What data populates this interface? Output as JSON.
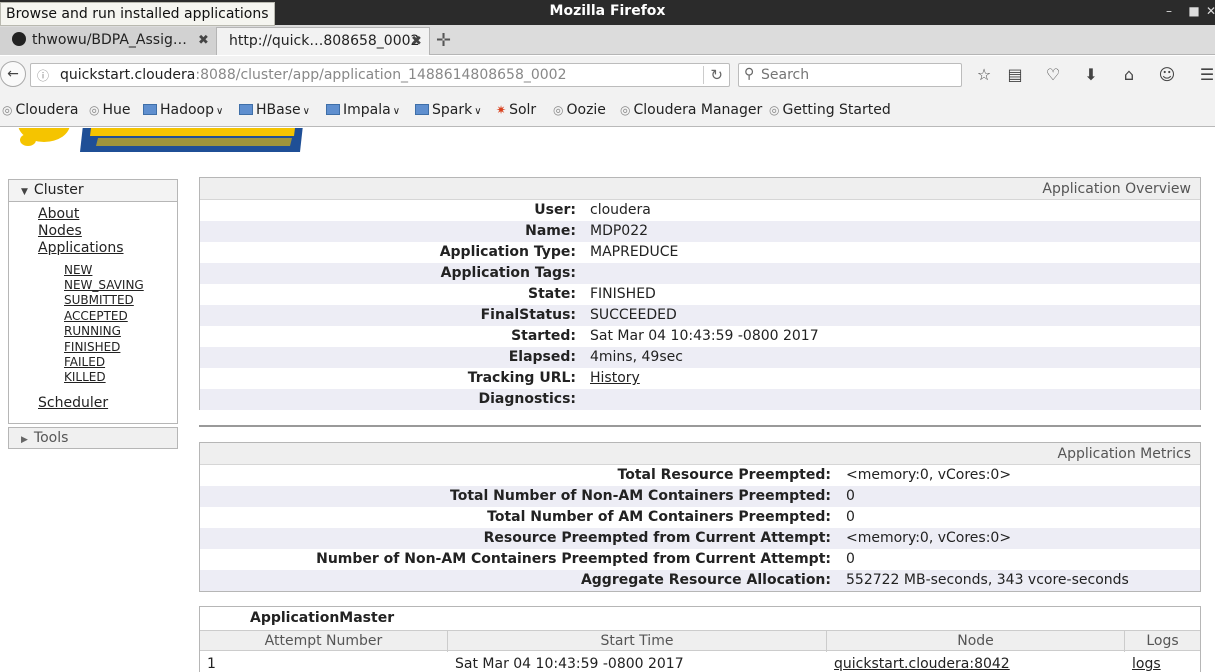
{
  "window": {
    "title": "Mozilla Firefox",
    "tooltip": "Browse and run installed applications"
  },
  "tabs": [
    {
      "label": "thwowu/BDPA_Assig…",
      "active": false
    },
    {
      "label": "http://quick…808658_0002",
      "active": true
    }
  ],
  "navbar": {
    "url_host": "quickstart.cloudera",
    "url_path": ":8088/cluster/app/application_1488614808658_0002",
    "search_placeholder": "Search"
  },
  "bookmarks": [
    {
      "label": "Cloudera",
      "type": "site"
    },
    {
      "label": "Hue",
      "type": "site"
    },
    {
      "label": "Hadoop",
      "type": "folder"
    },
    {
      "label": "HBase",
      "type": "folder"
    },
    {
      "label": "Impala",
      "type": "folder"
    },
    {
      "label": "Spark",
      "type": "folder"
    },
    {
      "label": "Solr",
      "type": "solr"
    },
    {
      "label": "Oozie",
      "type": "site"
    },
    {
      "label": "Cloudera Manager",
      "type": "site"
    },
    {
      "label": "Getting Started",
      "type": "site"
    }
  ],
  "sidebar": {
    "cluster_label": "Cluster",
    "links": [
      "About",
      "Nodes",
      "Applications"
    ],
    "app_states": [
      "NEW",
      "NEW_SAVING",
      "SUBMITTED",
      "ACCEPTED",
      "RUNNING",
      "FINISHED",
      "FAILED",
      "KILLED"
    ],
    "scheduler_label": "Scheduler",
    "tools_label": "Tools"
  },
  "overview": {
    "title": "Application Overview",
    "rows": [
      {
        "label": "User:",
        "value": "cloudera"
      },
      {
        "label": "Name:",
        "value": "MDP022"
      },
      {
        "label": "Application Type:",
        "value": "MAPREDUCE"
      },
      {
        "label": "Application Tags:",
        "value": ""
      },
      {
        "label": "State:",
        "value": "FINISHED"
      },
      {
        "label": "FinalStatus:",
        "value": "SUCCEEDED"
      },
      {
        "label": "Started:",
        "value": "Sat Mar 04 10:43:59 -0800 2017"
      },
      {
        "label": "Elapsed:",
        "value": "4mins, 49sec"
      },
      {
        "label": "Tracking URL:",
        "value": "History"
      },
      {
        "label": "Diagnostics:",
        "value": ""
      }
    ]
  },
  "metrics": {
    "title": "Application Metrics",
    "rows": [
      {
        "label": "Total Resource Preempted:",
        "value": "<memory:0, vCores:0>"
      },
      {
        "label": "Total Number of Non-AM Containers Preempted:",
        "value": "0"
      },
      {
        "label": "Total Number of AM Containers Preempted:",
        "value": "0"
      },
      {
        "label": "Resource Preempted from Current Attempt:",
        "value": "<memory:0, vCores:0>"
      },
      {
        "label": "Number of Non-AM Containers Preempted from Current Attempt:",
        "value": "0"
      },
      {
        "label": "Aggregate Resource Allocation:",
        "value": "552722 MB-seconds, 343 vcore-seconds"
      }
    ]
  },
  "attempts": {
    "title": "ApplicationMaster",
    "columns": [
      "Attempt Number",
      "Start Time",
      "Node",
      "Logs"
    ],
    "rows": [
      {
        "attempt": "1",
        "start": "Sat Mar 04 10:43:59 -0800 2017",
        "node": "quickstart.cloudera:8042",
        "logs": "logs"
      }
    ]
  },
  "colors": {
    "titlebar": "#2b2b2b",
    "chrome": "#f2f2f2",
    "odd_row": "#ededf5",
    "logo_yellow": "#f5c400",
    "logo_blue": "#1f4f96"
  }
}
